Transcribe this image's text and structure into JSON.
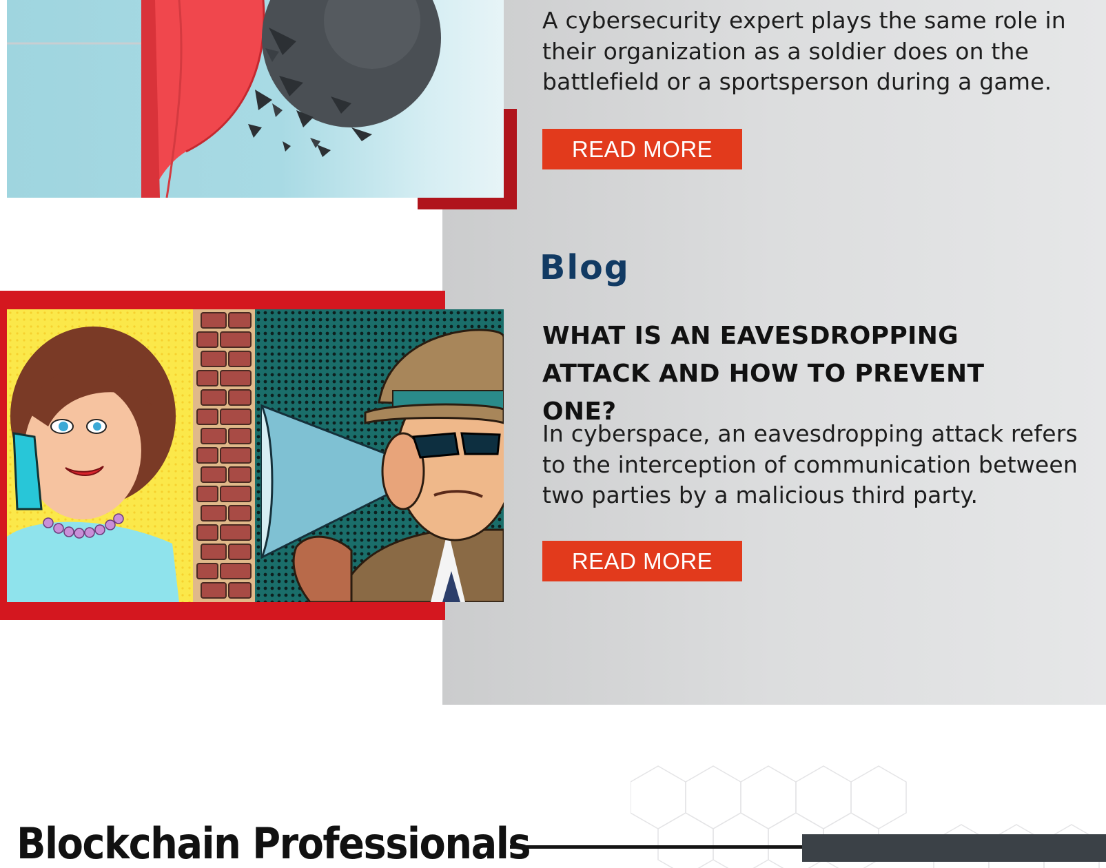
{
  "posts": [
    {
      "excerpt": "A cybersecurity expert plays the same role in their organization as a soldier does on the battlefield or a sportsperson during a game.",
      "read_more_label": "READ MORE"
    },
    {
      "category": "Blog",
      "title": "WHAT IS AN EAVESDROPPING ATTACK AND HOW TO PREVENT ONE?",
      "excerpt": "In cyberspace, an eavesdropping attack refers to the interception of communication between two parties by a malicious third party.",
      "read_more_label": "READ MORE"
    }
  ],
  "section": {
    "heading": "Blockchain Professionals"
  },
  "colors": {
    "accent_red": "#e23a1c",
    "frame_red": "#d4171f",
    "category_blue": "#113a63",
    "dark_bar": "#3b4147"
  }
}
